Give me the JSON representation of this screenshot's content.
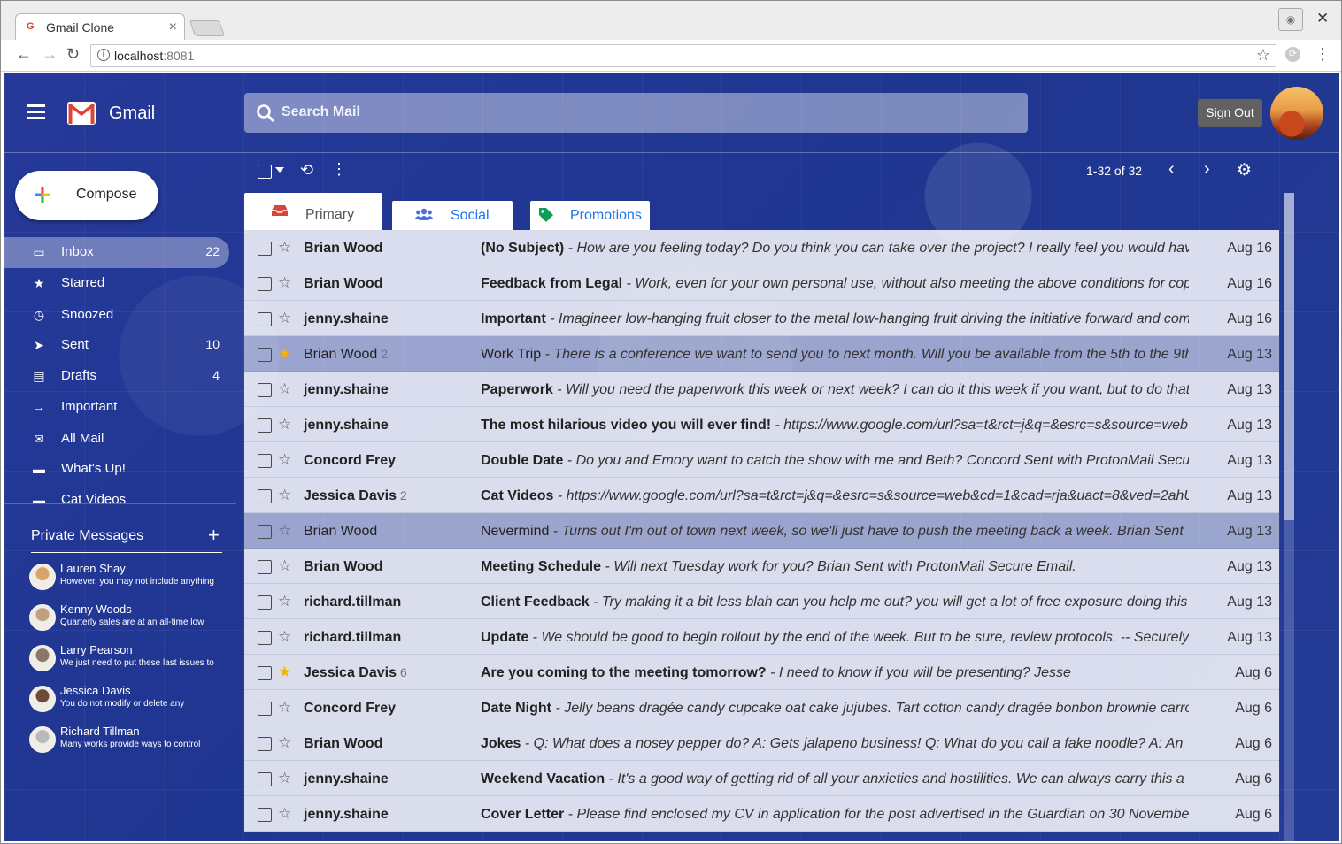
{
  "browser": {
    "tab_title": "Gmail Clone",
    "url_host": "localhost",
    "url_port": ":8081"
  },
  "header": {
    "brand": "Gmail",
    "search_placeholder": "Search Mail",
    "sign_out": "Sign Out"
  },
  "sidebar": {
    "compose": "Compose",
    "items": [
      {
        "label": "Inbox",
        "count": "22",
        "icon": "inbox-icon"
      },
      {
        "label": "Starred",
        "count": "",
        "icon": "star-icon"
      },
      {
        "label": "Snoozed",
        "count": "",
        "icon": "clock-icon"
      },
      {
        "label": "Sent",
        "count": "10",
        "icon": "send-icon"
      },
      {
        "label": "Drafts",
        "count": "4",
        "icon": "draft-icon"
      },
      {
        "label": "Important",
        "count": "",
        "icon": "arrow-right-icon"
      },
      {
        "label": "All Mail",
        "count": "",
        "icon": "envelope-icon"
      },
      {
        "label": "What's Up!",
        "count": "",
        "icon": "folder-icon"
      },
      {
        "label": "Cat Videos",
        "count": "",
        "icon": "folder-icon"
      }
    ],
    "private_messages": {
      "title": "Private Messages",
      "items": [
        {
          "name": "Lauren Shay",
          "preview": "However, you may not include anything"
        },
        {
          "name": "Kenny Woods",
          "preview": "Quarterly sales are at an all-time low"
        },
        {
          "name": "Larry Pearson",
          "preview": "We just need to put these last issues to"
        },
        {
          "name": "Jessica Davis",
          "preview": "You do not modify or delete any"
        },
        {
          "name": "Richard Tillman",
          "preview": "Many works provide ways to control"
        }
      ]
    }
  },
  "toolbar": {
    "pager": "1-32 of 32"
  },
  "tabs": [
    {
      "label": "Primary",
      "color": "#555555",
      "icon_color": "#db4437"
    },
    {
      "label": "Social",
      "color": "#1a73e8",
      "icon_color": "#1a73e8"
    },
    {
      "label": "Promotions",
      "color": "#1a73e8",
      "icon_color": "#0f9d58"
    }
  ],
  "emails": [
    {
      "sender": "Brian Wood",
      "count": "",
      "subject": "(No Subject)",
      "snippet": " - How are you feeling today? Do you think you can take over the project? I really feel you would hav",
      "date": "Aug 16",
      "starred": false,
      "unread": true
    },
    {
      "sender": "Brian Wood",
      "count": "",
      "subject": "Feedback from Legal",
      "snippet": " - Work, even for your own personal use, without also meeting the above conditions for cop",
      "date": "Aug 16",
      "starred": false,
      "unread": true
    },
    {
      "sender": "jenny.shaine",
      "count": "",
      "subject": "Important",
      "snippet": " - Imagineer low-hanging fruit closer to the metal low-hanging fruit driving the initiative forward and com",
      "date": "Aug 16",
      "starred": false,
      "unread": true
    },
    {
      "sender": "Brian Wood",
      "count": "2",
      "subject": "Work Trip",
      "snippet": " - There is a conference we want to send you to next month. Will you be available from the 5th to the 9th",
      "date": "Aug 13",
      "starred": true,
      "unread": false
    },
    {
      "sender": "jenny.shaine",
      "count": "",
      "subject": "Paperwork",
      "snippet": " - Will you need the paperwork this week or next week? I can do it this week if you want, but to do that",
      "date": "Aug 13",
      "starred": false,
      "unread": true
    },
    {
      "sender": "jenny.shaine",
      "count": "",
      "subject": "The most hilarious video you will ever find!",
      "snippet": " - https://www.google.com/url?sa=t&rct=j&q=&esrc=s&source=web",
      "date": "Aug 13",
      "starred": false,
      "unread": true
    },
    {
      "sender": "Concord Frey",
      "count": "",
      "subject": "Double Date",
      "snippet": " - Do you and Emory want to catch the show with me and Beth? Concord Sent with ProtonMail Secu",
      "date": "Aug 13",
      "starred": false,
      "unread": true
    },
    {
      "sender": "Jessica Davis",
      "count": "2",
      "subject": "Cat Videos",
      "snippet": " - https://www.google.com/url?sa=t&rct=j&q=&esrc=s&source=web&cd=1&cad=rja&uact=8&ved=2ahU",
      "date": "Aug 13",
      "starred": false,
      "unread": true
    },
    {
      "sender": "Brian Wood",
      "count": "",
      "subject": "Nevermind",
      "snippet": " - Turns out I'm out of town next week, so we'll just have to push the meeting back a week. Brian Sent",
      "date": "Aug 13",
      "starred": false,
      "unread": false
    },
    {
      "sender": "Brian Wood",
      "count": "",
      "subject": "Meeting Schedule",
      "snippet": " - Will next Tuesday work for you? Brian Sent with ProtonMail Secure Email.",
      "date": "Aug 13",
      "starred": false,
      "unread": true
    },
    {
      "sender": "richard.tillman",
      "count": "",
      "subject": "Client Feedback",
      "snippet": " - Try making it a bit less blah can you help me out? you will get a lot of free exposure doing this",
      "date": "Aug 13",
      "starred": false,
      "unread": true
    },
    {
      "sender": "richard.tillman",
      "count": "",
      "subject": "Update",
      "snippet": " - We should be good to begin rollout by the end of the week. But to be sure, review protocols. -- Securely",
      "date": "Aug 13",
      "starred": false,
      "unread": true
    },
    {
      "sender": "Jessica Davis",
      "count": "6",
      "subject": "Are you coming to the meeting tomorrow?",
      "snippet": " - I need to know if you will be presenting? Jesse",
      "date": "Aug 6",
      "starred": true,
      "unread": true
    },
    {
      "sender": "Concord Frey",
      "count": "",
      "subject": "Date Night",
      "snippet": " - Jelly beans dragée candy cupcake oat cake jujubes. Tart cotton candy dragée bonbon brownie carro",
      "date": "Aug 6",
      "starred": false,
      "unread": true
    },
    {
      "sender": "Brian Wood",
      "count": "",
      "subject": "Jokes",
      "snippet": " - Q: What does a nosey pepper do? A: Gets jalapeno business! Q: What do you call a fake noodle? A: An",
      "date": "Aug 6",
      "starred": false,
      "unread": true
    },
    {
      "sender": "jenny.shaine",
      "count": "",
      "subject": "Weekend Vacation",
      "snippet": " - It's a good way of getting rid of all your anxieties and hostilities. We can always carry this a",
      "date": "Aug 6",
      "starred": false,
      "unread": true
    },
    {
      "sender": "jenny.shaine",
      "count": "",
      "subject": "Cover Letter",
      "snippet": " - Please find enclosed my CV in application for the post advertised in the Guardian on 30 Novembe",
      "date": "Aug 6",
      "starred": false,
      "unread": true
    }
  ]
}
